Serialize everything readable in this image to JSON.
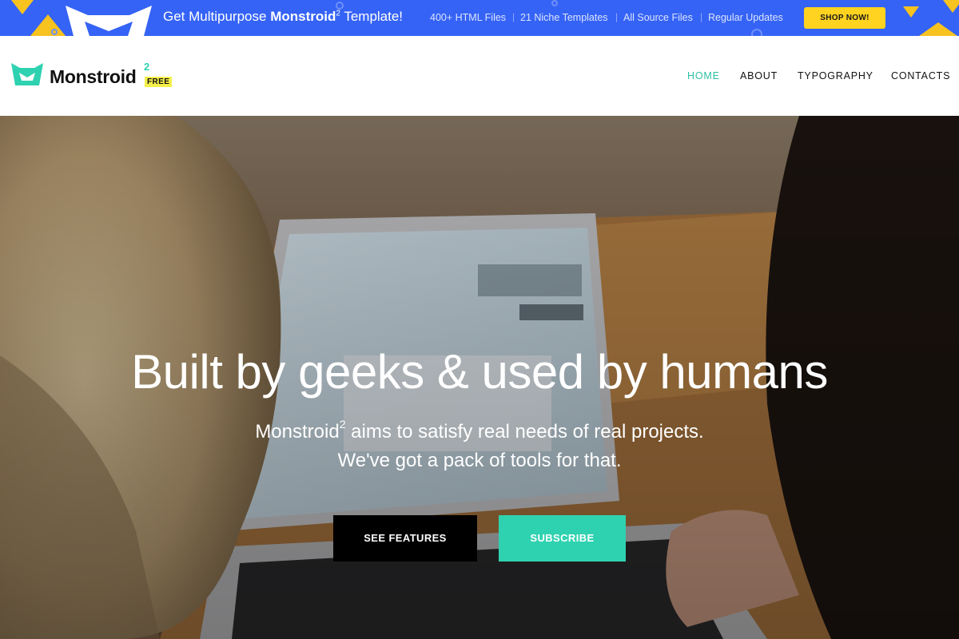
{
  "promo": {
    "headline_prefix": "Get Multipurpose ",
    "headline_brand": "Monstroid",
    "headline_sup": "2",
    "headline_suffix": " Template!",
    "features": [
      "400+ HTML Files",
      "21 Niche Templates",
      "All Source Files",
      "Regular Updates"
    ],
    "separator": "|",
    "cta_label": "SHOP NOW!",
    "colors": {
      "background": "#3563f5",
      "accent": "#ffd320"
    },
    "icons": [
      "monstroid-mask-icon",
      "triangle-decoration",
      "ring-decoration"
    ]
  },
  "header": {
    "logo_name": "Monstroid",
    "logo_sup": "2",
    "logo_badge": "FREE",
    "nav": [
      {
        "label": "HOME",
        "active": true
      },
      {
        "label": "ABOUT",
        "active": false
      },
      {
        "label": "TYPOGRAPHY",
        "active": false
      },
      {
        "label": "CONTACTS",
        "active": false
      }
    ],
    "colors": {
      "brand": "#2fd2b0",
      "active_nav": "#2fc1a4"
    }
  },
  "hero": {
    "title": "Built by geeks & used by humans",
    "subtitle_brand": "Monstroid",
    "subtitle_sup": "2",
    "subtitle_rest": " aims to satisfy real needs of real projects.",
    "subtitle_line2": "We've got a pack of tools for that.",
    "primary_button": "SEE FEATURES",
    "secondary_button": "SUBSCRIBE",
    "colors": {
      "primary_button": "#000000",
      "secondary_button": "#2fd2b0"
    }
  }
}
